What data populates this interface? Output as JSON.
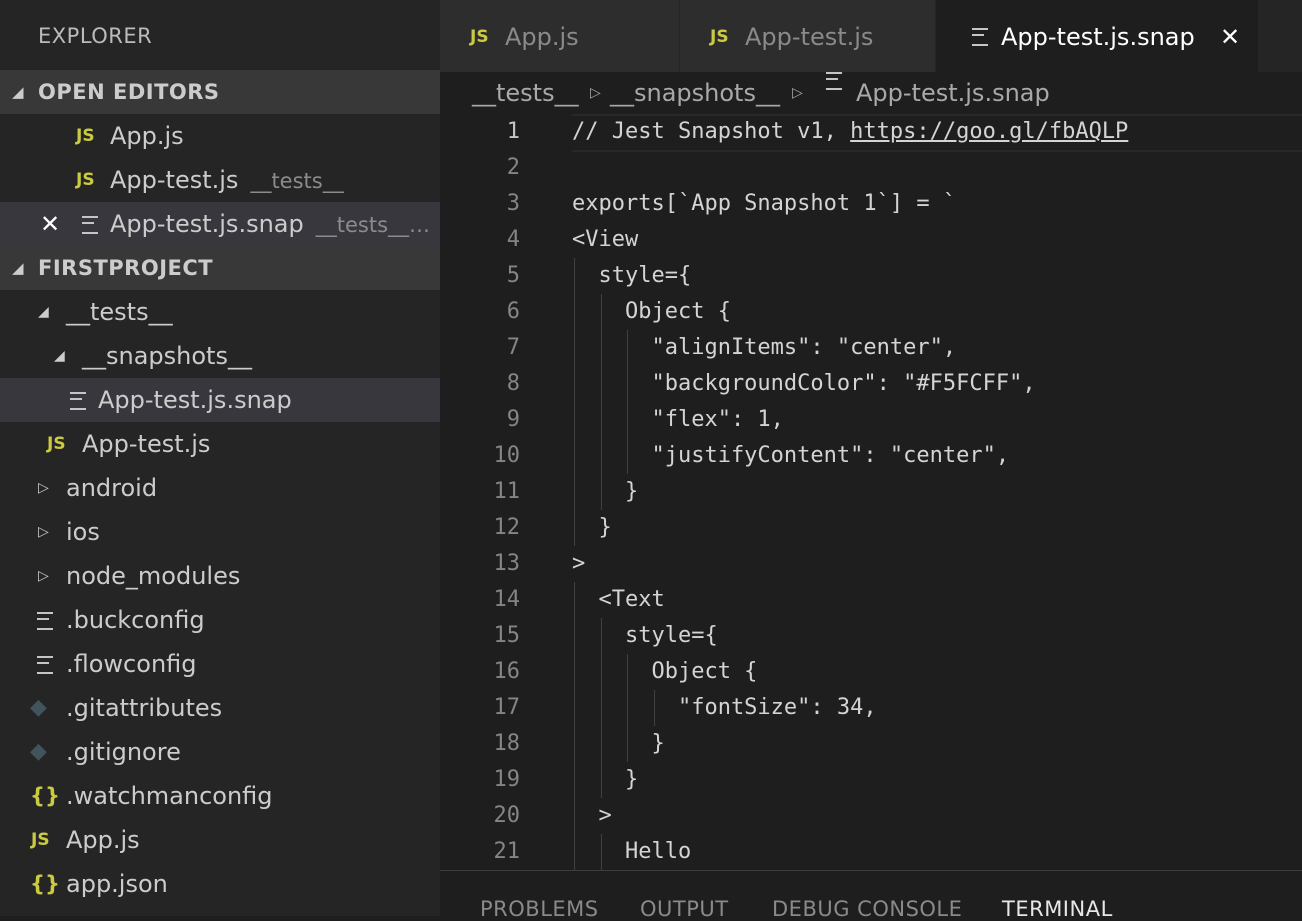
{
  "sidebar": {
    "title": "EXPLORER",
    "open_editors_header": "OPEN EDITORS",
    "open_editors": [
      {
        "label": "App.js",
        "desc": ""
      },
      {
        "label": "App-test.js",
        "desc": "__tests__"
      },
      {
        "label": "App-test.js.snap",
        "desc": "__tests__…"
      }
    ],
    "project_header": "FIRSTPROJECT",
    "tree": [
      {
        "label": "__tests__"
      },
      {
        "label": "__snapshots__"
      },
      {
        "label": "App-test.js.snap"
      },
      {
        "label": "App-test.js"
      },
      {
        "label": "android"
      },
      {
        "label": "ios"
      },
      {
        "label": "node_modules"
      },
      {
        "label": ".buckconfig"
      },
      {
        "label": ".flowconfig"
      },
      {
        "label": ".gitattributes"
      },
      {
        "label": ".gitignore"
      },
      {
        "label": ".watchmanconfig"
      },
      {
        "label": "App.js"
      },
      {
        "label": "app.json"
      }
    ],
    "icon_js": "JS",
    "icon_braces": "{}"
  },
  "tabs": [
    {
      "label": "App.js",
      "icon": "js-file-icon"
    },
    {
      "label": "App-test.js",
      "icon": "js-file-icon"
    },
    {
      "label": "App-test.js.snap",
      "icon": "text-file-icon",
      "close": "✕"
    }
  ],
  "breadcrumb": [
    "__tests__",
    "__snapshots__",
    "App-test.js.snap"
  ],
  "editor": {
    "lines": [
      {
        "n": "1",
        "text": "// Jest Snapshot v1, ",
        "url": "https://goo.gl/fbAQLP"
      },
      {
        "n": "2",
        "text": ""
      },
      {
        "n": "3",
        "text": "exports[`App Snapshot 1`] = `"
      },
      {
        "n": "4",
        "text": "<View"
      },
      {
        "n": "5",
        "text": "  style={"
      },
      {
        "n": "6",
        "text": "    Object {"
      },
      {
        "n": "7",
        "text": "      \"alignItems\": \"center\","
      },
      {
        "n": "8",
        "text": "      \"backgroundColor\": \"#F5FCFF\","
      },
      {
        "n": "9",
        "text": "      \"flex\": 1,"
      },
      {
        "n": "10",
        "text": "      \"justifyContent\": \"center\","
      },
      {
        "n": "11",
        "text": "    }"
      },
      {
        "n": "12",
        "text": "  }"
      },
      {
        "n": "13",
        "text": ">"
      },
      {
        "n": "14",
        "text": "  <Text"
      },
      {
        "n": "15",
        "text": "    style={"
      },
      {
        "n": "16",
        "text": "      Object {"
      },
      {
        "n": "17",
        "text": "        \"fontSize\": 34,"
      },
      {
        "n": "18",
        "text": "      }"
      },
      {
        "n": "19",
        "text": "    }"
      },
      {
        "n": "20",
        "text": "  >"
      },
      {
        "n": "21",
        "text": "    Hello"
      }
    ]
  },
  "panel": {
    "tabs": [
      "PROBLEMS",
      "OUTPUT",
      "DEBUG CONSOLE",
      "TERMINAL"
    ]
  },
  "colors": {
    "js_icon": "#cbcb41",
    "sidebar_bg": "#252526",
    "editor_bg": "#1e1e1e",
    "section_header_bg": "#383838"
  }
}
